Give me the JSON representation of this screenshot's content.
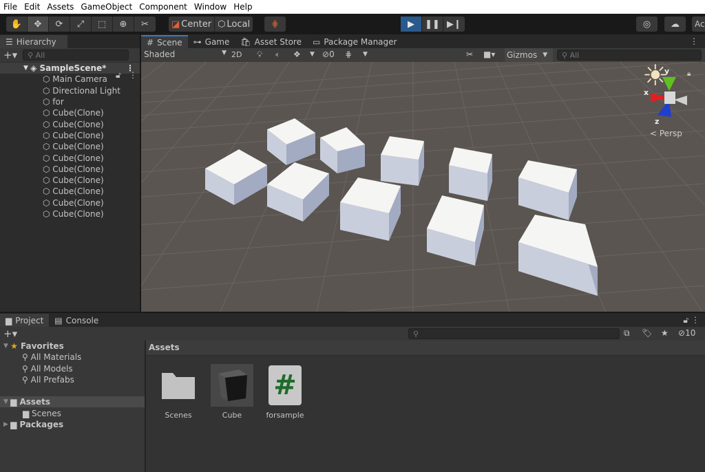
{
  "menu": [
    "File",
    "Edit",
    "Assets",
    "GameObject",
    "Component",
    "Window",
    "Help"
  ],
  "toolbar": {
    "tools": [
      "hand-tool",
      "move-tool",
      "rotate-tool",
      "scale-tool",
      "rect-tool",
      "transform-tool",
      "custom-tool"
    ],
    "pivot": "Center",
    "space": "Local",
    "account_label": "Ac"
  },
  "hierarchy": {
    "title": "Hierarchy",
    "search_placeholder": "All",
    "scene": "SampleScene*",
    "items": [
      "Main Camera",
      "Directional Light",
      "for",
      "Cube(Clone)",
      "Cube(Clone)",
      "Cube(Clone)",
      "Cube(Clone)",
      "Cube(Clone)",
      "Cube(Clone)",
      "Cube(Clone)",
      "Cube(Clone)",
      "Cube(Clone)",
      "Cube(Clone)"
    ]
  },
  "scene_tabs": [
    {
      "label": "Scene",
      "icon": "grid-icon"
    },
    {
      "label": "Game",
      "icon": "gamepad-icon"
    },
    {
      "label": "Asset Store",
      "icon": "bag-icon"
    },
    {
      "label": "Package Manager",
      "icon": "package-icon"
    }
  ],
  "scene_toolbar": {
    "draw_mode": "Shaded",
    "mode_2d": "2D",
    "hidden_count": "0",
    "gizmos": "Gizmos",
    "search_placeholder": "All"
  },
  "gizmo": {
    "x": "x",
    "y": "y",
    "z": "z",
    "projection": "Persp"
  },
  "colors": {
    "accent": "#3a79bb",
    "play": "#2a5a8c",
    "script_hash": "#1f6b2a",
    "favorite_star": "#e0a81a",
    "axis_x": "#e02020",
    "axis_y": "#5fc020",
    "axis_z": "#1f3fd0"
  },
  "bottom_tabs": [
    "Project",
    "Console"
  ],
  "project": {
    "favorites_label": "Favorites",
    "favorites": [
      "All Materials",
      "All Models",
      "All Prefabs"
    ],
    "assets_label": "Assets",
    "asset_children": [
      "Scenes"
    ],
    "packages_label": "Packages",
    "breadcrumb": "Assets",
    "hidden_count": "10",
    "files": [
      {
        "name": "Scenes",
        "type": "folder"
      },
      {
        "name": "Cube",
        "type": "prefab"
      },
      {
        "name": "forsample",
        "type": "script"
      }
    ]
  }
}
